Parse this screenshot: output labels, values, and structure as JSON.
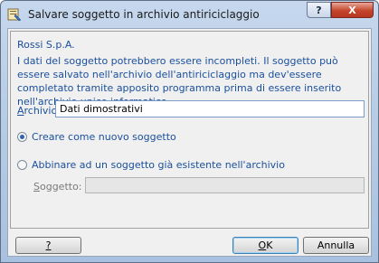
{
  "window": {
    "title": "Salvare soggetto in archivio antiriciclaggio",
    "help_glyph": "?",
    "close_glyph": "X"
  },
  "body": {
    "company": "Rossi S.p.A.",
    "message": "I dati del soggetto potrebbero essere incompleti. Il soggetto può essere salvato nell'archivio dell'antiriciclaggio ma dev'essere completato tramite apposito programma prima di essere inserito nell'archivio unico informatico."
  },
  "archivio": {
    "label_access": "A",
    "label_rest": "rchivio:",
    "value": "Dati dimostrativi"
  },
  "options": {
    "create_label": "Creare come nuovo soggetto",
    "create_checked": true,
    "link_label": "Abbinare ad un soggetto già esistente nell'archivio",
    "link_checked": false
  },
  "soggetto": {
    "label_access": "S",
    "label_rest": "oggetto:",
    "value": ""
  },
  "buttons": {
    "help": "?",
    "ok_access": "O",
    "ok_rest": "K",
    "cancel": "Annulla"
  }
}
